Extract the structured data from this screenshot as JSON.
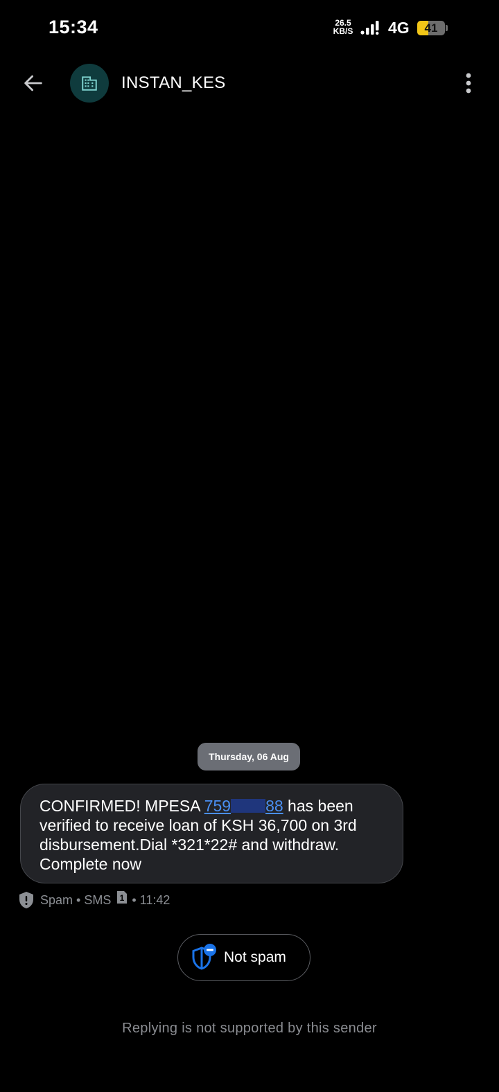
{
  "status_bar": {
    "time": "15:34",
    "net_speed_value": "26.5",
    "net_speed_unit": "KB/S",
    "network_type": "4G",
    "battery_level": "41",
    "battery_fraction": 0.41,
    "battery_color": "#f2c617"
  },
  "header": {
    "back_icon": "arrow-left-icon",
    "avatar_icon": "building-icon",
    "contact_name": "INSTAN_KES",
    "more_icon": "more-vert-icon"
  },
  "conversation": {
    "date_chip": "Thursday, 06 Aug",
    "message": {
      "text_before": "CONFIRMED! MPESA ",
      "link_prefix": "759",
      "link_suffix": "88",
      "text_after": " has been verified to receive loan of KSH 36,700 on 3rd disbursement.Dial *321*22# and withdraw. Complete now"
    },
    "meta": {
      "category": "Spam",
      "separator": "•",
      "channel": "SMS",
      "sim_slot": "1",
      "time": "11:42"
    }
  },
  "actions": {
    "not_spam_label": "Not spam"
  },
  "footer": {
    "reply_note": "Replying is not supported by this sender"
  },
  "colors": {
    "background": "#000000",
    "bubble": "#222327",
    "link": "#4a8ff2",
    "accent_blue": "#1a73e8",
    "avatar_bg": "#0f3b3d"
  }
}
